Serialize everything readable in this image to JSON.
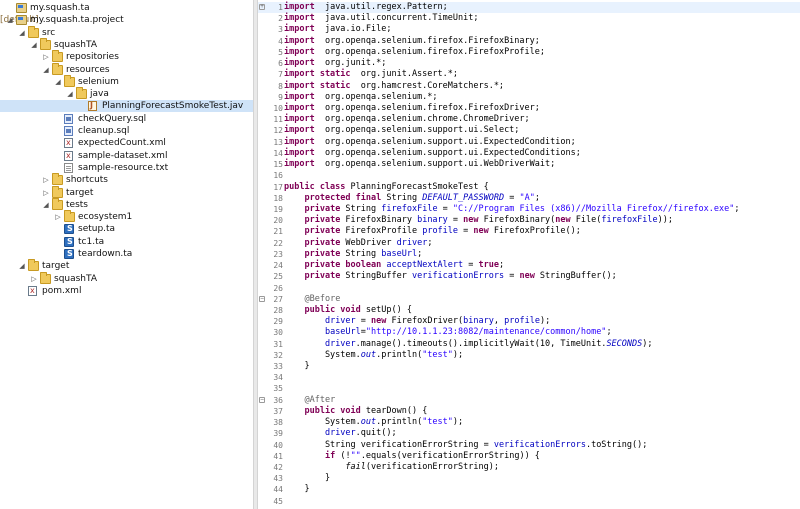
{
  "tree": [
    {
      "label": "my.squash.ta",
      "icon": "project",
      "depth": 0,
      "expanded": null
    },
    {
      "label": "my.squash.ta.project",
      "decoration": "[default]",
      "icon": "project",
      "depth": 0,
      "expanded": true
    },
    {
      "label": "src",
      "icon": "folder",
      "depth": 1,
      "expanded": true
    },
    {
      "label": "squashTA",
      "icon": "folder",
      "depth": 2,
      "expanded": true
    },
    {
      "label": "repositories",
      "icon": "folder",
      "depth": 3,
      "expanded": false
    },
    {
      "label": "resources",
      "icon": "folder",
      "depth": 3,
      "expanded": true
    },
    {
      "label": "selenium",
      "icon": "folder",
      "depth": 4,
      "expanded": true
    },
    {
      "label": "java",
      "icon": "folder",
      "depth": 5,
      "expanded": true
    },
    {
      "label": "PlanningForecastSmokeTest.jav",
      "icon": "java",
      "depth": 6,
      "expanded": null,
      "selected": true
    },
    {
      "label": "checkQuery.sql",
      "icon": "sql",
      "depth": 4,
      "expanded": null
    },
    {
      "label": "cleanup.sql",
      "icon": "sql",
      "depth": 4,
      "expanded": null
    },
    {
      "label": "expectedCount.xml",
      "icon": "xml",
      "depth": 4,
      "expanded": null
    },
    {
      "label": "sample-dataset.xml",
      "icon": "xml",
      "depth": 4,
      "expanded": null
    },
    {
      "label": "sample-resource.txt",
      "icon": "txt",
      "depth": 4,
      "expanded": null
    },
    {
      "label": "shortcuts",
      "icon": "folder",
      "depth": 3,
      "expanded": false
    },
    {
      "label": "target",
      "icon": "folder",
      "depth": 3,
      "expanded": false
    },
    {
      "label": "tests",
      "icon": "folder",
      "depth": 3,
      "expanded": true
    },
    {
      "label": "ecosystem1",
      "icon": "folder",
      "depth": 4,
      "expanded": false
    },
    {
      "label": "setup.ta",
      "icon": "ta",
      "depth": 4,
      "expanded": null
    },
    {
      "label": "tc1.ta",
      "icon": "ta",
      "depth": 4,
      "expanded": null
    },
    {
      "label": "teardown.ta",
      "icon": "ta",
      "depth": 4,
      "expanded": null
    },
    {
      "label": "target",
      "icon": "folder",
      "depth": 1,
      "expanded": true
    },
    {
      "label": "squashTA",
      "icon": "folder",
      "depth": 2,
      "expanded": false
    },
    {
      "label": "pom.xml",
      "icon": "xml",
      "depth": 1,
      "expanded": null
    }
  ],
  "code": [
    {
      "n": "1",
      "fold": "+",
      "current": true,
      "t": [
        [
          "kw",
          "import"
        ],
        [
          "",
          "  java.util.regex.Pattern;"
        ]
      ]
    },
    {
      "n": "2",
      "t": [
        [
          "kw",
          "import"
        ],
        [
          "",
          "  java.util.concurrent.TimeUnit;"
        ]
      ]
    },
    {
      "n": "3",
      "t": [
        [
          "kw",
          "import"
        ],
        [
          "",
          "  java.io.File;"
        ]
      ]
    },
    {
      "n": "4",
      "t": [
        [
          "kw",
          "import"
        ],
        [
          "",
          "  org.openqa.selenium.firefox.FirefoxBinary;"
        ]
      ]
    },
    {
      "n": "5",
      "t": [
        [
          "kw",
          "import"
        ],
        [
          "",
          "  org.openqa.selenium.firefox.FirefoxProfile;"
        ]
      ]
    },
    {
      "n": "6",
      "t": [
        [
          "kw",
          "import"
        ],
        [
          "",
          "  org.junit.*;"
        ]
      ]
    },
    {
      "n": "7",
      "t": [
        [
          "kw",
          "import static"
        ],
        [
          "",
          "  org.junit.Assert.*;"
        ]
      ]
    },
    {
      "n": "8",
      "t": [
        [
          "kw",
          "import static"
        ],
        [
          "",
          "  org.hamcrest.CoreMatchers.*;"
        ]
      ]
    },
    {
      "n": "9",
      "t": [
        [
          "kw",
          "import"
        ],
        [
          "",
          "  org.openqa.selenium.*;"
        ]
      ]
    },
    {
      "n": "10",
      "t": [
        [
          "kw",
          "import"
        ],
        [
          "",
          "  org.openqa.selenium.firefox.FirefoxDriver;"
        ]
      ]
    },
    {
      "n": "11",
      "t": [
        [
          "kw",
          "import"
        ],
        [
          "",
          "  org.openqa.selenium.chrome.ChromeDriver;"
        ]
      ]
    },
    {
      "n": "12",
      "t": [
        [
          "kw",
          "import"
        ],
        [
          "",
          "  org.openqa.selenium.support.ui.Select;"
        ]
      ]
    },
    {
      "n": "13",
      "t": [
        [
          "kw",
          "import"
        ],
        [
          "",
          "  org.openqa.selenium.support.ui.ExpectedCondition;"
        ]
      ]
    },
    {
      "n": "14",
      "t": [
        [
          "kw",
          "import"
        ],
        [
          "",
          "  org.openqa.selenium.support.ui.ExpectedConditions;"
        ]
      ]
    },
    {
      "n": "15",
      "t": [
        [
          "kw",
          "import"
        ],
        [
          "",
          "  org.openqa.selenium.support.ui.WebDriverWait;"
        ]
      ]
    },
    {
      "n": "16",
      "t": []
    },
    {
      "n": "17",
      "t": [
        [
          "kw",
          "public class"
        ],
        [
          "",
          " PlanningForecastSmokeTest {"
        ]
      ]
    },
    {
      "n": "18",
      "t": [
        [
          "",
          "    "
        ],
        [
          "kw",
          "protected final"
        ],
        [
          "",
          " String "
        ],
        [
          "sfld",
          "DEFAULT_PASSWORD"
        ],
        [
          "",
          " = "
        ],
        [
          "str",
          "\"A\""
        ],
        [
          "",
          ";"
        ]
      ]
    },
    {
      "n": "19",
      "t": [
        [
          "",
          "    "
        ],
        [
          "kw",
          "private"
        ],
        [
          "",
          " String "
        ],
        [
          "fld",
          "firefoxFile"
        ],
        [
          "",
          " = "
        ],
        [
          "str",
          "\"C://Program Files (x86)//Mozilla Firefox//firefox.exe\""
        ],
        [
          "",
          ";"
        ]
      ]
    },
    {
      "n": "20",
      "t": [
        [
          "",
          "    "
        ],
        [
          "kw",
          "private"
        ],
        [
          "",
          " FirefoxBinary "
        ],
        [
          "fld",
          "binary"
        ],
        [
          "",
          " = "
        ],
        [
          "kw",
          "new"
        ],
        [
          "",
          " FirefoxBinary("
        ],
        [
          "kw",
          "new"
        ],
        [
          "",
          " File("
        ],
        [
          "fld",
          "firefoxFile"
        ],
        [
          "",
          "));"
        ]
      ]
    },
    {
      "n": "21",
      "t": [
        [
          "",
          "    "
        ],
        [
          "kw",
          "private"
        ],
        [
          "",
          " FirefoxProfile "
        ],
        [
          "fld",
          "profile"
        ],
        [
          "",
          " = "
        ],
        [
          "kw",
          "new"
        ],
        [
          "",
          " FirefoxProfile();"
        ]
      ]
    },
    {
      "n": "22",
      "t": [
        [
          "",
          "    "
        ],
        [
          "kw",
          "private"
        ],
        [
          "",
          " WebDriver "
        ],
        [
          "fld",
          "driver"
        ],
        [
          "",
          ";"
        ]
      ]
    },
    {
      "n": "23",
      "t": [
        [
          "",
          "    "
        ],
        [
          "kw",
          "private"
        ],
        [
          "",
          " String "
        ],
        [
          "fld",
          "baseUrl"
        ],
        [
          "",
          ";"
        ]
      ]
    },
    {
      "n": "24",
      "t": [
        [
          "",
          "    "
        ],
        [
          "kw",
          "private boolean"
        ],
        [
          "",
          " "
        ],
        [
          "fld",
          "acceptNextAlert"
        ],
        [
          "",
          " = "
        ],
        [
          "kw",
          "true"
        ],
        [
          "",
          ";"
        ]
      ]
    },
    {
      "n": "25",
      "t": [
        [
          "",
          "    "
        ],
        [
          "kw",
          "private"
        ],
        [
          "",
          " StringBuffer "
        ],
        [
          "fld",
          "verificationErrors"
        ],
        [
          "",
          " = "
        ],
        [
          "kw",
          "new"
        ],
        [
          "",
          " StringBuffer();"
        ]
      ]
    },
    {
      "n": "26",
      "t": []
    },
    {
      "n": "27",
      "fold": "-",
      "t": [
        [
          "",
          "    "
        ],
        [
          "ann",
          "@Before"
        ]
      ]
    },
    {
      "n": "28",
      "t": [
        [
          "",
          "    "
        ],
        [
          "kw",
          "public void"
        ],
        [
          "",
          " setUp() {"
        ]
      ]
    },
    {
      "n": "29",
      "t": [
        [
          "",
          "        "
        ],
        [
          "fld",
          "driver"
        ],
        [
          "",
          " = "
        ],
        [
          "kw",
          "new"
        ],
        [
          "",
          " FirefoxDriver("
        ],
        [
          "fld",
          "binary"
        ],
        [
          "",
          ", "
        ],
        [
          "fld",
          "profile"
        ],
        [
          "",
          ");"
        ]
      ]
    },
    {
      "n": "30",
      "t": [
        [
          "",
          "        "
        ],
        [
          "fld",
          "baseUrl"
        ],
        [
          "",
          "="
        ],
        [
          "str",
          "\"http://10.1.1.23:8082/maintenance/common/home\""
        ],
        [
          "",
          ";"
        ]
      ]
    },
    {
      "n": "31",
      "t": [
        [
          "",
          "        "
        ],
        [
          "fld",
          "driver"
        ],
        [
          "",
          ".manage().timeouts().implicitlyWait(10, TimeUnit."
        ],
        [
          "sfld",
          "SECONDS"
        ],
        [
          "",
          ");"
        ]
      ]
    },
    {
      "n": "32",
      "t": [
        [
          "",
          "        System."
        ],
        [
          "sfld",
          "out"
        ],
        [
          "",
          ".println("
        ],
        [
          "str",
          "\"test\""
        ],
        [
          "",
          ");"
        ]
      ]
    },
    {
      "n": "33",
      "t": [
        [
          "",
          "    }"
        ]
      ]
    },
    {
      "n": "34",
      "t": []
    },
    {
      "n": "35",
      "t": []
    },
    {
      "n": "36",
      "fold": "-",
      "t": [
        [
          "",
          "    "
        ],
        [
          "ann",
          "@After"
        ]
      ]
    },
    {
      "n": "37",
      "t": [
        [
          "",
          "    "
        ],
        [
          "kw",
          "public void"
        ],
        [
          "",
          " tearDown() {"
        ]
      ]
    },
    {
      "n": "38",
      "t": [
        [
          "",
          "        System."
        ],
        [
          "sfld",
          "out"
        ],
        [
          "",
          ".println("
        ],
        [
          "str",
          "\"test\""
        ],
        [
          "",
          ");"
        ]
      ]
    },
    {
      "n": "39",
      "t": [
        [
          "",
          "        "
        ],
        [
          "fld",
          "driver"
        ],
        [
          "",
          ".quit();"
        ]
      ]
    },
    {
      "n": "40",
      "t": [
        [
          "",
          "        String verificationErrorString = "
        ],
        [
          "fld",
          "verificationErrors"
        ],
        [
          "",
          ".toString();"
        ]
      ]
    },
    {
      "n": "41",
      "t": [
        [
          "",
          "        "
        ],
        [
          "kw",
          "if"
        ],
        [
          "",
          " (!"
        ],
        [
          "str",
          "\"\""
        ],
        [
          "",
          ".equals(verificationErrorString)) {"
        ]
      ]
    },
    {
      "n": "42",
      "t": [
        [
          "",
          "            "
        ],
        [
          "ital",
          "fail"
        ],
        [
          "",
          "(verificationErrorString);"
        ]
      ]
    },
    {
      "n": "43",
      "t": [
        [
          "",
          "        }"
        ]
      ]
    },
    {
      "n": "44",
      "t": [
        [
          "",
          "    }"
        ]
      ]
    },
    {
      "n": "45",
      "t": []
    }
  ]
}
